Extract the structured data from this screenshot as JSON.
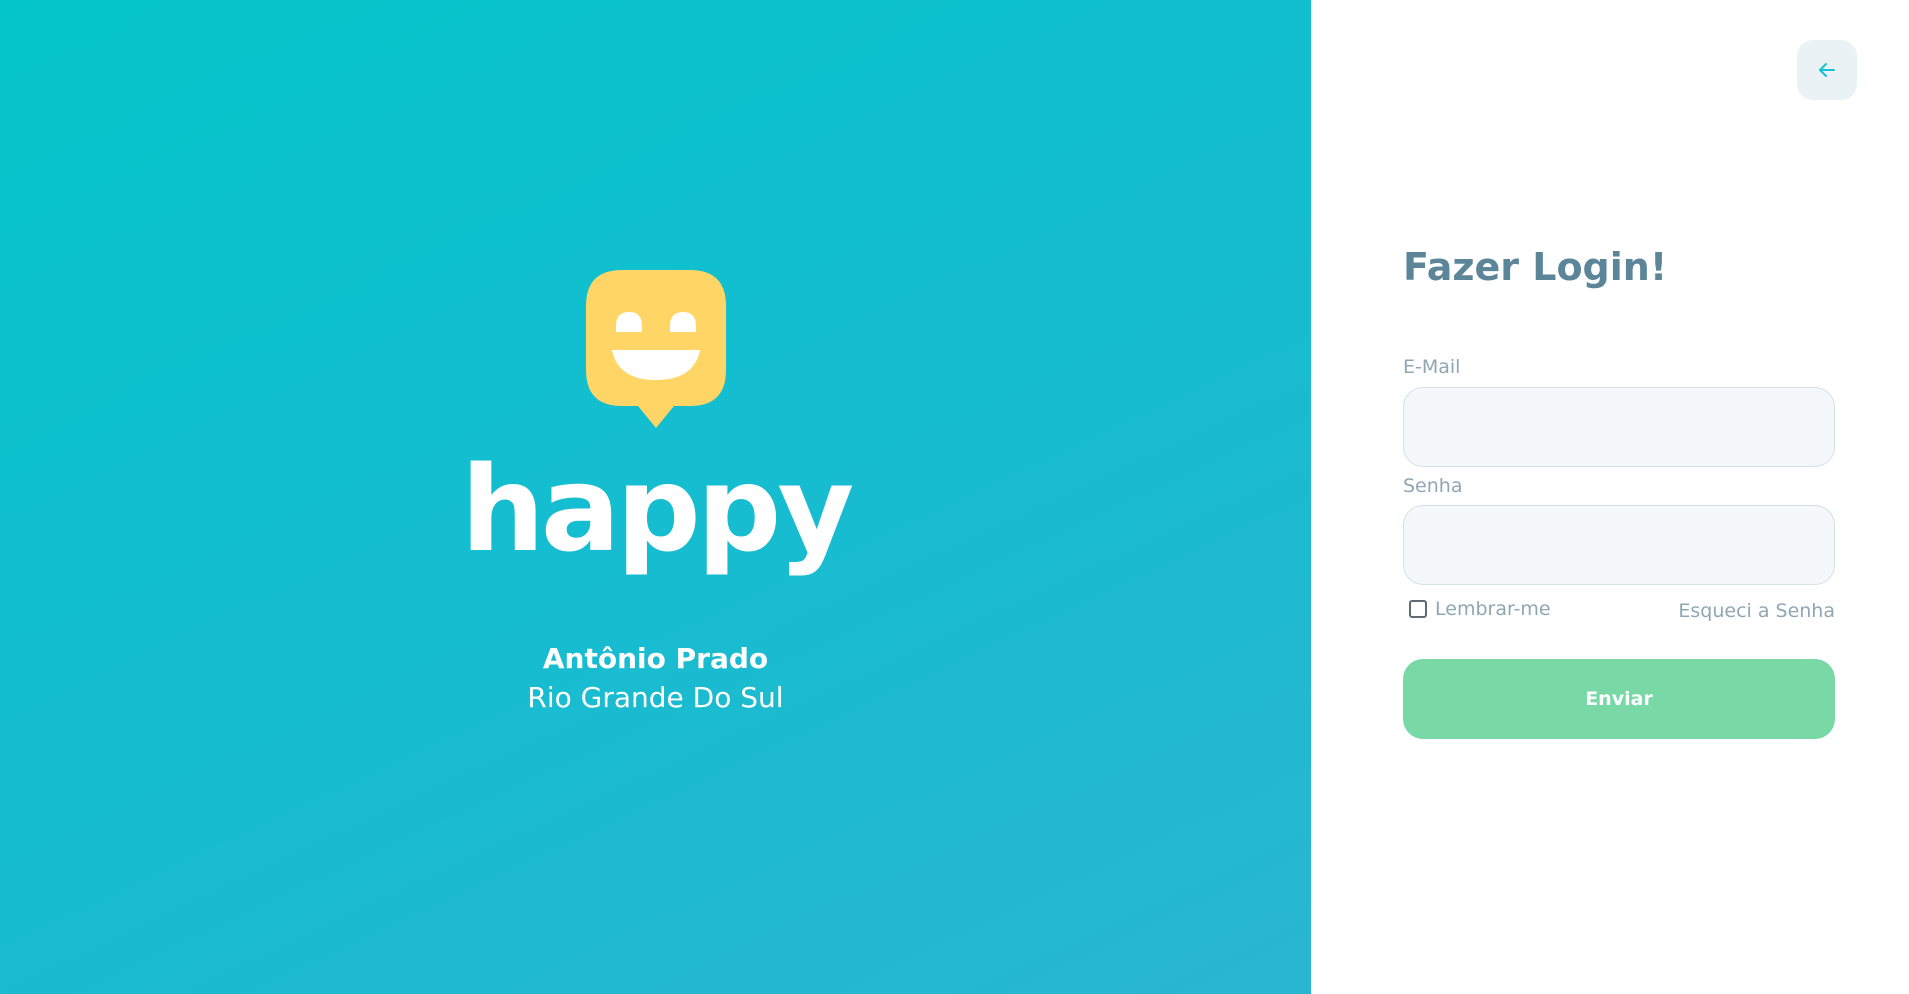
{
  "colors": {
    "hero_gradient_start": "#05c6ca",
    "hero_gradient_end": "#29b6d1",
    "logo_yellow": "#ffd666",
    "title_color": "#5c8599",
    "label_color": "#8fa7b2",
    "submit_color": "#78d9a7",
    "back_button_bg": "#ebf2f5",
    "back_arrow_color": "#15c3d6"
  },
  "hero": {
    "logo_icon": "smiley-chat-bubble-icon",
    "wordmark": "happy",
    "location": {
      "city": "Antônio Prado",
      "state": "Rio Grande Do Sul"
    }
  },
  "login": {
    "back_icon": "arrow-left-icon",
    "title": "Fazer Login!",
    "email": {
      "label": "E-Mail",
      "value": ""
    },
    "password": {
      "label": "Senha",
      "value": ""
    },
    "remember": {
      "label": "Lembrar-me",
      "checked": false
    },
    "forgot_label": "Esqueci a Senha",
    "submit_label": "Enviar"
  }
}
